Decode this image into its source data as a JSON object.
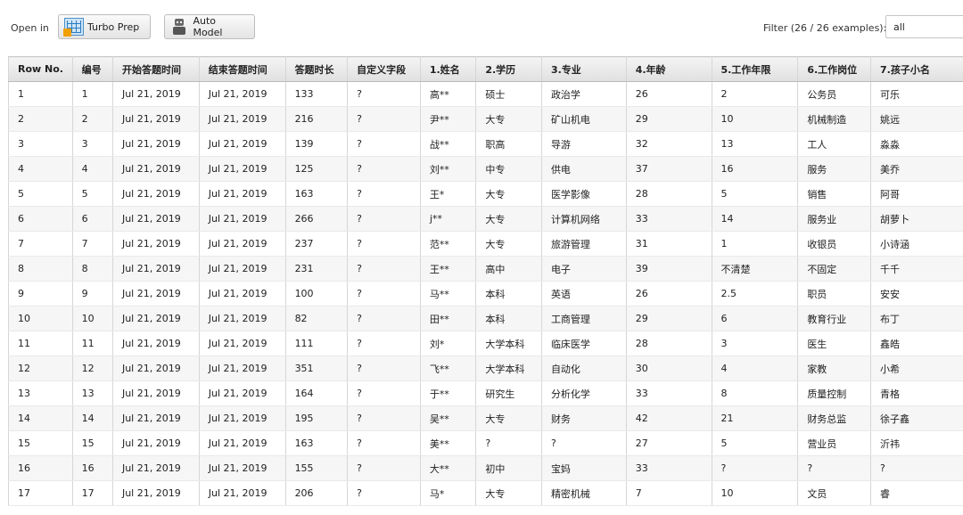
{
  "toolbar": {
    "open_in_label": "Open in",
    "turbo_prep_label": "Turbo Prep",
    "auto_model_label": "Auto Model",
    "filter_label": "Filter (26 / 26 examples):",
    "filter_value": "all"
  },
  "table": {
    "columns": [
      "Row No.",
      "编号",
      "开始答题时间",
      "结束答题时间",
      "答题时长",
      "自定义字段",
      "1.姓名",
      "2.学历",
      "3.专业",
      "4.年龄",
      "5.工作年限",
      "6.工作岗位",
      "7.孩子小名"
    ],
    "rows": [
      [
        "1",
        "1",
        "Jul 21, 2019",
        "Jul 21, 2019",
        "133",
        "?",
        "高**",
        "硕士",
        "政治学",
        "26",
        "2",
        "公务员",
        "可乐"
      ],
      [
        "2",
        "2",
        "Jul 21, 2019",
        "Jul 21, 2019",
        "216",
        "?",
        "尹**",
        "大专",
        "矿山机电",
        "29",
        "10",
        "机械制造",
        "姚远"
      ],
      [
        "3",
        "3",
        "Jul 21, 2019",
        "Jul 21, 2019",
        "139",
        "?",
        "战**",
        "职高",
        "导游",
        "32",
        "13",
        "工人",
        "淼淼"
      ],
      [
        "4",
        "4",
        "Jul 21, 2019",
        "Jul 21, 2019",
        "125",
        "?",
        "刘**",
        "中专",
        "供电",
        "37",
        "16",
        "服务",
        "美乔"
      ],
      [
        "5",
        "5",
        "Jul 21, 2019",
        "Jul 21, 2019",
        "163",
        "?",
        "王*",
        "大专",
        "医学影像",
        "28",
        "5",
        "销售",
        "阿哥"
      ],
      [
        "6",
        "6",
        "Jul 21, 2019",
        "Jul 21, 2019",
        "266",
        "?",
        "j**",
        "大专",
        "计算机网络",
        "33",
        "14",
        "服务业",
        "胡萝卜"
      ],
      [
        "7",
        "7",
        "Jul 21, 2019",
        "Jul 21, 2019",
        "237",
        "?",
        "范**",
        "大专",
        "旅游管理",
        "31",
        "1",
        "收银员",
        "小诗涵"
      ],
      [
        "8",
        "8",
        "Jul 21, 2019",
        "Jul 21, 2019",
        "231",
        "?",
        "王**",
        "高中",
        "电子",
        "39",
        "不清楚",
        "不固定",
        "千千"
      ],
      [
        "9",
        "9",
        "Jul 21, 2019",
        "Jul 21, 2019",
        "100",
        "?",
        "马**",
        "本科",
        "英语",
        "26",
        "2.5",
        "职员",
        "安安"
      ],
      [
        "10",
        "10",
        "Jul 21, 2019",
        "Jul 21, 2019",
        "82",
        "?",
        "田**",
        "本科",
        "工商管理",
        "29",
        "6",
        "教育行业",
        "布丁"
      ],
      [
        "11",
        "11",
        "Jul 21, 2019",
        "Jul 21, 2019",
        "111",
        "?",
        "刘*",
        "大学本科",
        "临床医学",
        "28",
        "3",
        "医生",
        "鑫皓"
      ],
      [
        "12",
        "12",
        "Jul 21, 2019",
        "Jul 21, 2019",
        "351",
        "?",
        "飞**",
        "大学本科",
        "自动化",
        "30",
        "4",
        "家教",
        "小希"
      ],
      [
        "13",
        "13",
        "Jul 21, 2019",
        "Jul 21, 2019",
        "164",
        "?",
        "于**",
        "研究生",
        "分析化学",
        "33",
        "8",
        "质量控制",
        "青格"
      ],
      [
        "14",
        "14",
        "Jul 21, 2019",
        "Jul 21, 2019",
        "195",
        "?",
        "吴**",
        "大专",
        "财务",
        "42",
        "21",
        "财务总监",
        "徐子鑫"
      ],
      [
        "15",
        "15",
        "Jul 21, 2019",
        "Jul 21, 2019",
        "163",
        "?",
        "美**",
        "?",
        "?",
        "27",
        "5",
        "营业员",
        "沂祎"
      ],
      [
        "16",
        "16",
        "Jul 21, 2019",
        "Jul 21, 2019",
        "155",
        "?",
        "大**",
        "初中",
        "宝妈",
        "33",
        "?",
        "?",
        "?"
      ],
      [
        "17",
        "17",
        "Jul 21, 2019",
        "Jul 21, 2019",
        "206",
        "?",
        "马*",
        "大专",
        "精密机械",
        "7",
        "10",
        "文员",
        "睿"
      ]
    ]
  }
}
